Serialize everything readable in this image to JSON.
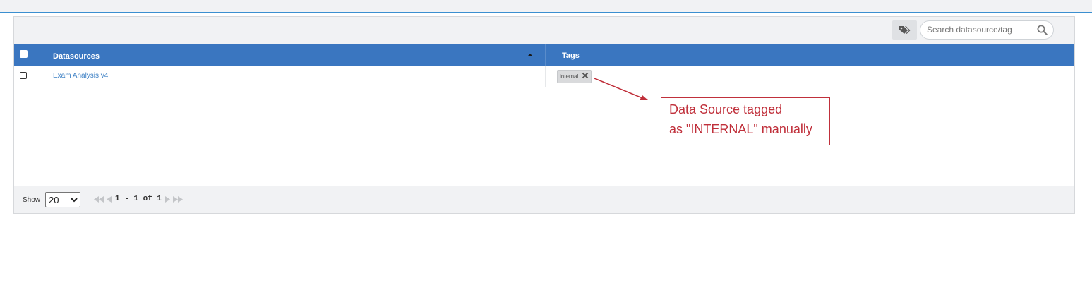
{
  "toolbar": {
    "tag_filter_icon": "tags-icon",
    "search_placeholder": "Search datasource/tag",
    "search_icon": "search-icon"
  },
  "table": {
    "columns": [
      "Datasources",
      "Tags"
    ],
    "sort_indicator": "ascending",
    "rows": [
      {
        "datasource": "Exam Analysis v4",
        "tags": [
          "internal"
        ]
      }
    ]
  },
  "footer": {
    "show_label": "Show",
    "page_size": "20",
    "page_size_options": [
      "20"
    ],
    "page_info": "1 - 1 of 1"
  },
  "annotation": {
    "line1": "Data Source tagged",
    "line2": "as \"INTERNAL\" manually",
    "color": "#c0303b"
  },
  "colors": {
    "header_bg": "#3a76c0",
    "link": "#3b7fc4",
    "panel_bg": "#f1f2f4"
  }
}
